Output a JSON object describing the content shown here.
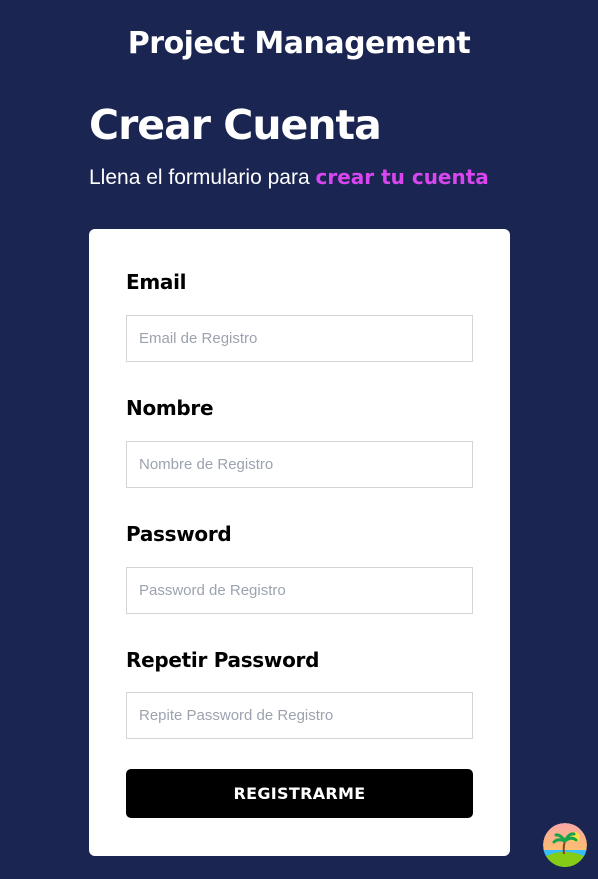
{
  "app": {
    "title": "Project Management"
  },
  "page": {
    "heading": "Crear Cuenta",
    "subtitle_prefix": "Llena el formulario para ",
    "subtitle_accent": "crear tu cuenta"
  },
  "form": {
    "fields": [
      {
        "label": "Email",
        "placeholder": "Email de Registro",
        "value": ""
      },
      {
        "label": "Nombre",
        "placeholder": "Nombre de Registro",
        "value": ""
      },
      {
        "label": "Password",
        "placeholder": "Password de Registro",
        "value": ""
      },
      {
        "label": "Repetir Password",
        "placeholder": "Repite Password de Registro",
        "value": ""
      }
    ],
    "submit_label": "REGISTRARME"
  },
  "floating_widget": {
    "icon": "island-sunset-icon"
  },
  "colors": {
    "background": "#1a2552",
    "accent": "#d946ef",
    "card": "#ffffff",
    "button": "#000000"
  }
}
